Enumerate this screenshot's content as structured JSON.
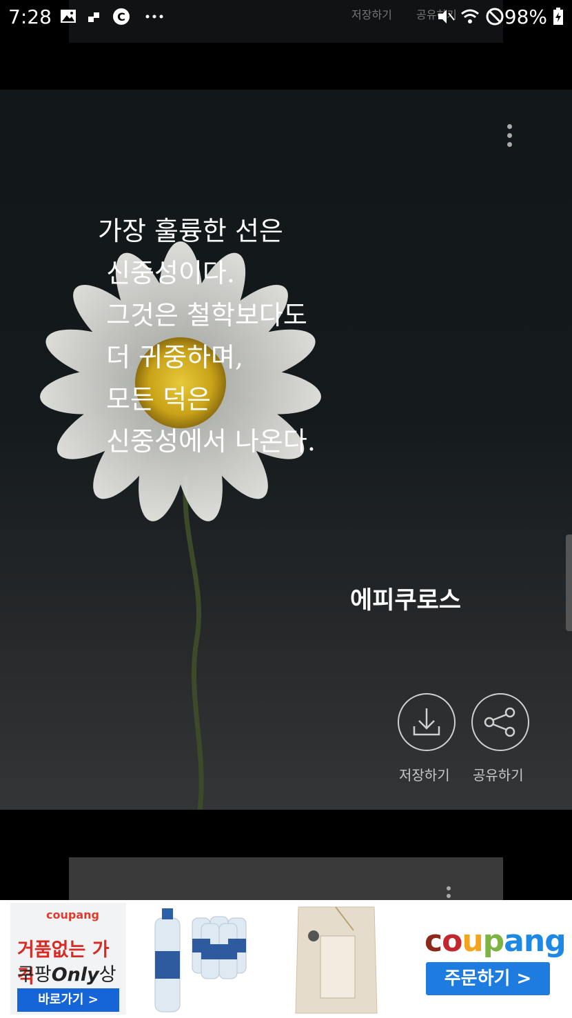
{
  "status_bar": {
    "time": "7:28",
    "battery": "98%"
  },
  "ghost_header": {
    "save_label": "저장하기",
    "share_label": "공유하기"
  },
  "quote_card": {
    "quote_lines": [
      "가장 훌륭한 선은",
      " 신중성이다.",
      " 그것은 철학보다도",
      " 더 귀중하며,",
      " 모든 덕은",
      " 신중성에서 나온다."
    ],
    "author": "에피쿠로스",
    "save_label": "저장하기",
    "share_label": "공유하기"
  },
  "ad_banner": {
    "tile1": {
      "brand": "coupang",
      "line1": "거품없는 가격",
      "line2_prefix": "쿠팡",
      "line2_only": "Only",
      "line2_suffix": "상품",
      "cta": "바로가기 >"
    },
    "tile4": {
      "logo_letters": [
        "c",
        "o",
        "u",
        "p",
        "a",
        "n",
        "g"
      ],
      "logo_colors": [
        "#8b2a1a",
        "#c1272d",
        "#f3a31c",
        "#7cb342",
        "#1e88e5",
        "#1e88e5",
        "#1e88e5"
      ],
      "cta": "주문하기 >"
    }
  }
}
